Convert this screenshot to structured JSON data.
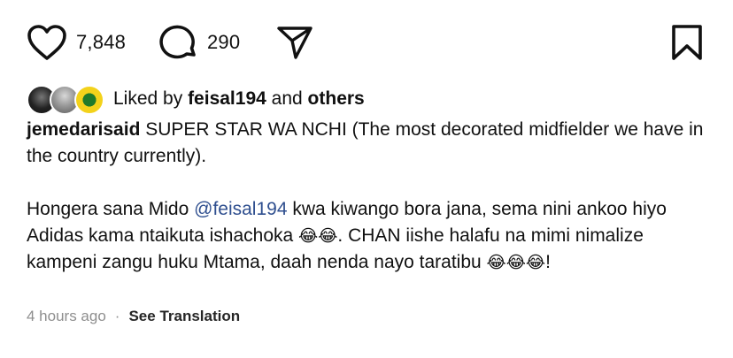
{
  "actions": {
    "likes_count": "7,848",
    "comments_count": "290",
    "icons": [
      "heart-icon",
      "comment-icon",
      "share-icon",
      "bookmark-icon"
    ]
  },
  "liked_by": {
    "prefix": "Liked by",
    "user": "feisal194",
    "joiner": "and",
    "others": "others"
  },
  "caption": {
    "username": "jemedarisaid",
    "text1": "SUPER STAR WA NCHI (The most decorated midfielder we have in the country currently).",
    "text2_a": "Hongera sana Mido ",
    "mention": "@feisal194",
    "text2_b": " kwa kiwango bora jana, sema nini ankoo hiyo Adidas kama ntaikuta ishachoka ",
    "emoji_a": "😂😂",
    "text2_c": ". CHAN iishe halafu na mimi nimalize kampeni zangu huku Mtama, daah nenda nayo taratibu ",
    "emoji_b": "😂😂😂",
    "text2_d": "!"
  },
  "meta": {
    "time": "4 hours ago",
    "separator": "·",
    "translation_link": "See Translation"
  }
}
